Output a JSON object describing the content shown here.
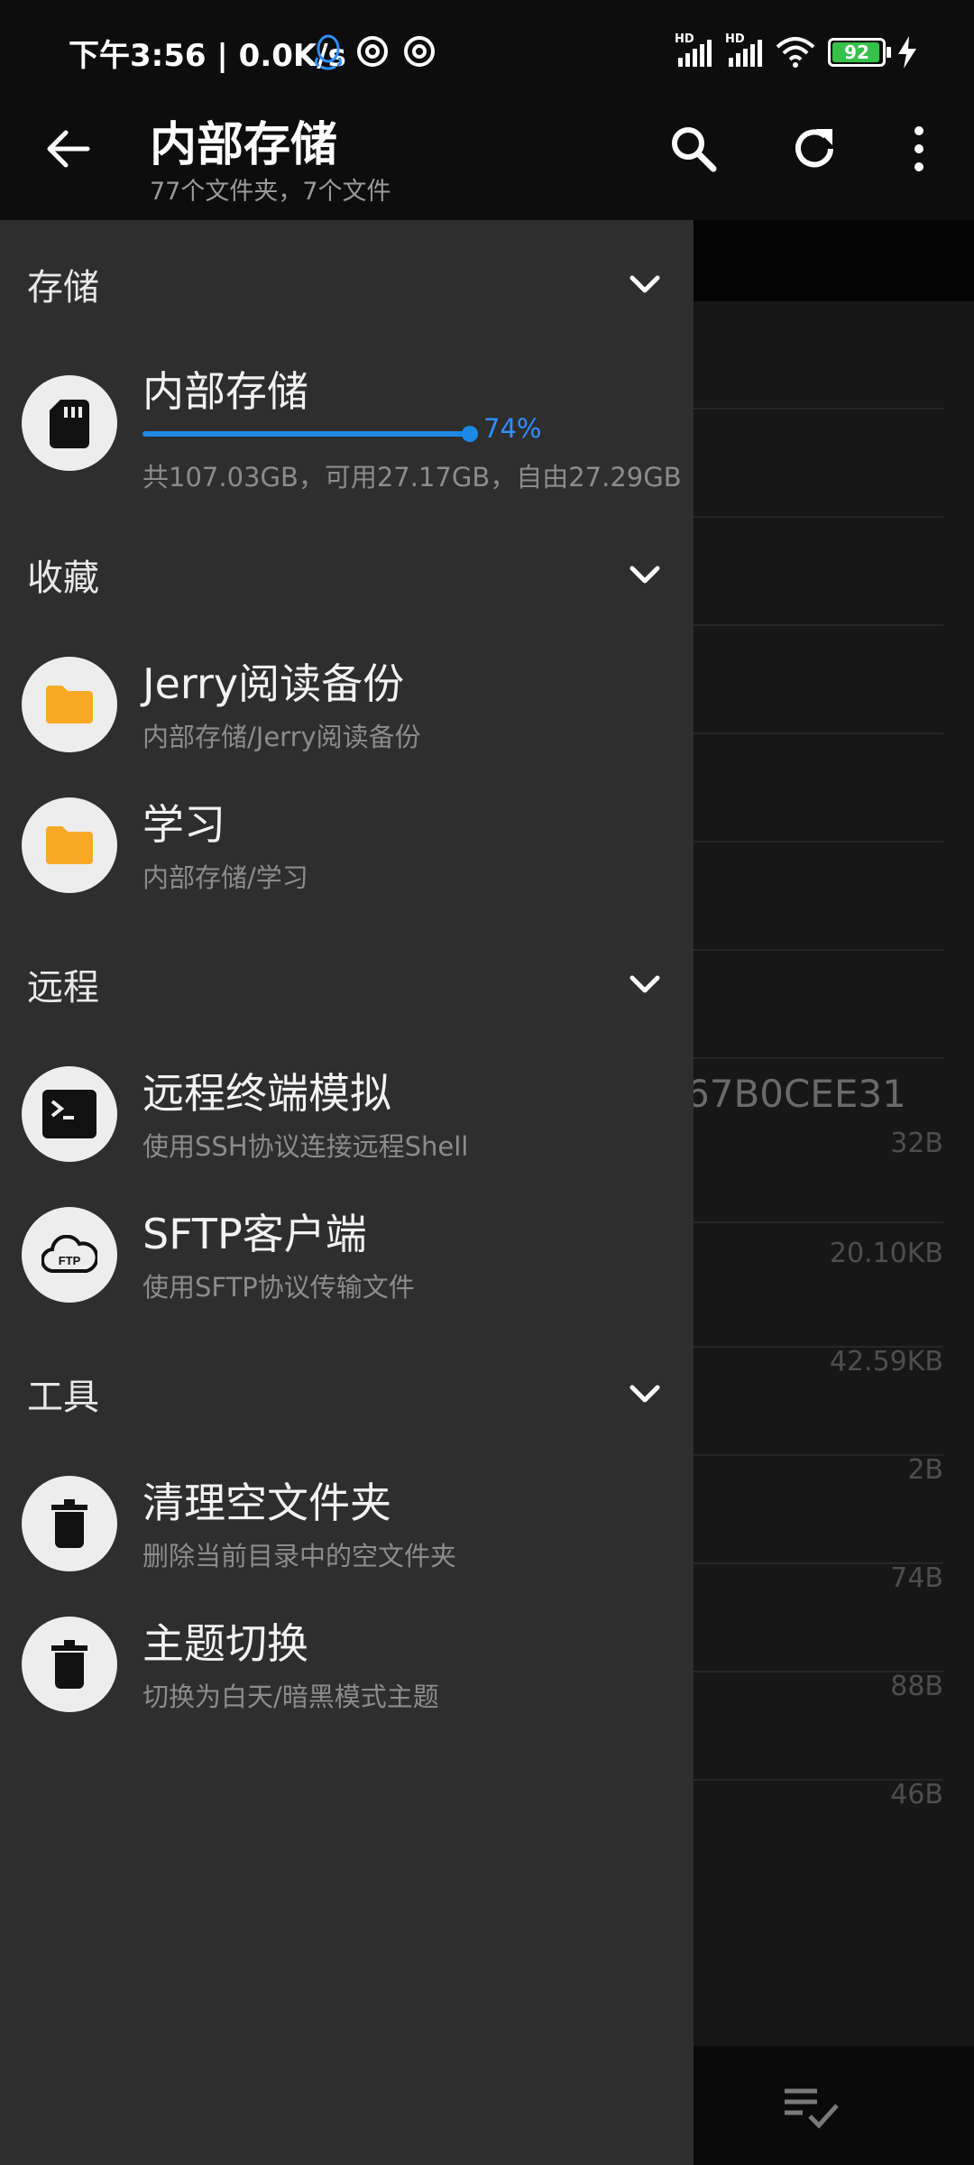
{
  "status_bar": {
    "text": "下午3:56 | 0.0K/s",
    "battery": "92",
    "hd1": "HD",
    "hd2": "HD"
  },
  "app_bar": {
    "title": "内部存储",
    "subtitle": "77个文件夹，7个文件"
  },
  "drawer": {
    "sections": {
      "storage": {
        "label": "存储"
      },
      "favorites": {
        "label": "收藏"
      },
      "remote": {
        "label": "远程"
      },
      "tools": {
        "label": "工具"
      }
    },
    "storage_item": {
      "title": "内部存储",
      "percent_label": "74%",
      "usage_fraction": 0.74,
      "detail": "共107.03GB，可用27.17GB，自由27.29GB"
    },
    "favorites": [
      {
        "title": "Jerry阅读备份",
        "path": "内部存储/Jerry阅读备份"
      },
      {
        "title": "学习",
        "path": "内部存储/学习"
      }
    ],
    "remote": [
      {
        "title": "远程终端模拟",
        "desc": "使用SSH协议连接远程Shell",
        "icon": "terminal-icon"
      },
      {
        "title": "SFTP客户端",
        "desc": "使用SFTP协议传输文件",
        "icon": "ftp-cloud-icon"
      }
    ],
    "tools": [
      {
        "title": "清理空文件夹",
        "desc": "删除当前目录中的空文件夹",
        "icon": "trash-icon"
      },
      {
        "title": "主题切换",
        "desc": "切换为白天/暗黑模式主题",
        "icon": "trash-icon"
      }
    ]
  },
  "background_list": {
    "partial_name": "67B0CEE31",
    "sizes": [
      "32B",
      "20.10KB",
      "42.59KB",
      "2B",
      "74B",
      "88B",
      "46B"
    ]
  },
  "colors": {
    "accent": "#1e88e5",
    "folder": "#f9a825",
    "drawer_bg": "#2e2e2e"
  }
}
